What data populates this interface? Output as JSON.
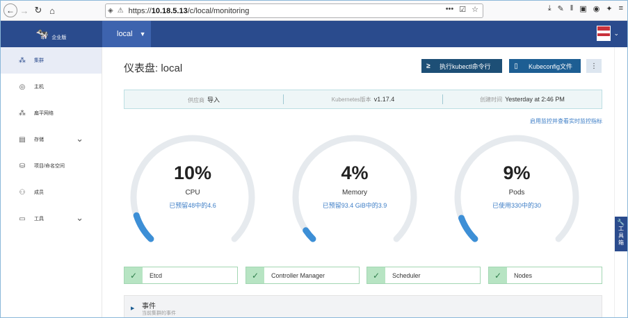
{
  "browser": {
    "url_prefix": "https://",
    "url_host": "10.18.5.13",
    "url_path": "/c/local/monitoring",
    "more_glyph": "•••"
  },
  "header": {
    "brand_label": "企业版",
    "cluster_name": "local",
    "accent_color": "#2a4b8d"
  },
  "sidebar": {
    "items": [
      {
        "label": "集群",
        "icon": "cluster-icon",
        "glyph": "⁂",
        "active": true,
        "expandable": false
      },
      {
        "label": "主机",
        "icon": "host-icon",
        "glyph": "◎",
        "active": false,
        "expandable": false
      },
      {
        "label": "扁平网络",
        "icon": "network-icon",
        "glyph": "⁂",
        "active": false,
        "expandable": false
      },
      {
        "label": "存储",
        "icon": "storage-icon",
        "glyph": "▤",
        "active": false,
        "expandable": true
      },
      {
        "label": "项目/命名空间",
        "icon": "project-icon",
        "glyph": "⛁",
        "active": false,
        "expandable": false
      },
      {
        "label": "成员",
        "icon": "members-icon",
        "glyph": "⚇",
        "active": false,
        "expandable": false
      },
      {
        "label": "工具",
        "icon": "tools-icon",
        "glyph": "▭",
        "active": false,
        "expandable": true
      }
    ]
  },
  "page": {
    "title": "仪表盘: local",
    "kubectl_button": "执行kubectl命令行",
    "kubeconfig_button": "Kubeconfig文件",
    "more_button": "⋮",
    "monitoring_link": "启用监控并查看实时监控指标"
  },
  "info": {
    "provider_label": "供应商",
    "provider_value": "导入",
    "k8s_label": "Kubernetes版本",
    "k8s_value": "v1.17.4",
    "created_label": "创建时间",
    "created_value": "Yesterday at 2:46 PM"
  },
  "gauges": [
    {
      "value": "10%",
      "label": "CPU",
      "sub": "已预留48中的4.6",
      "fraction": 0.1
    },
    {
      "value": "4%",
      "label": "Memory",
      "sub": "已预留93.4 GiB中的3.9",
      "fraction": 0.04
    },
    {
      "value": "9%",
      "label": "Pods",
      "sub": "已使用330中的30",
      "fraction": 0.09
    }
  ],
  "components": [
    {
      "label": "Etcd",
      "status": "ok"
    },
    {
      "label": "Controller Manager",
      "status": "ok"
    },
    {
      "label": "Scheduler",
      "status": "ok"
    },
    {
      "label": "Nodes",
      "status": "ok"
    }
  ],
  "events": {
    "title": "事件",
    "subtitle": "当前集群的事件"
  },
  "toolbox": {
    "label_line1": "工",
    "label_line2": "具",
    "label_line3": "箱"
  }
}
